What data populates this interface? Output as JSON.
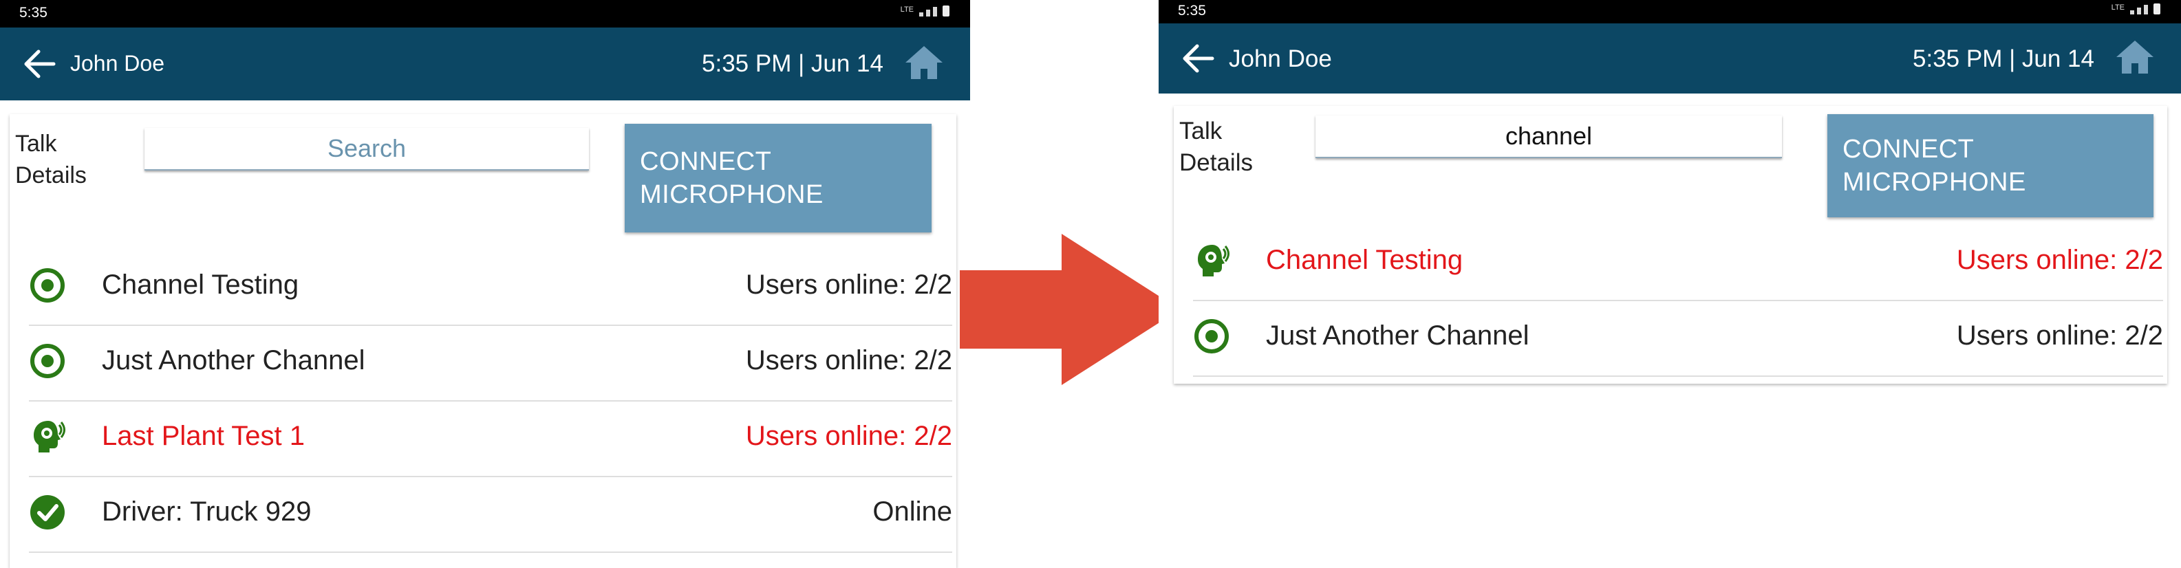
{
  "colors": {
    "appbar": "#0c4764",
    "button": "#6699b8",
    "alert_text": "#e3161a",
    "icon_green": "#2a7a16",
    "transition_arrow": "#e04b36"
  },
  "left": {
    "status_time": "5:35",
    "user_name": "John Doe",
    "datetime": "5:35 PM | Jun 14",
    "talk_label": "Talk\nDetails",
    "search": {
      "placeholder": "Search",
      "value": ""
    },
    "connect_label": "CONNECT\nMICROPHONE",
    "rows": [
      {
        "name": "Channel Testing",
        "status": "Users online: 2/2",
        "icon": "target-icon",
        "alert": false
      },
      {
        "name": "Just Another Channel",
        "status": "Users online: 2/2",
        "icon": "target-icon",
        "alert": false
      },
      {
        "name": "Last Plant Test 1",
        "status": "Users online: 2/2",
        "icon": "talking-head-icon",
        "alert": true
      },
      {
        "name": "Driver: Truck 929",
        "status": "Online",
        "icon": "check-circle-icon",
        "alert": false
      }
    ]
  },
  "right": {
    "status_time": "5:35",
    "user_name": "John Doe",
    "datetime": "5:35 PM | Jun 14",
    "talk_label": "Talk\nDetails",
    "search": {
      "placeholder": "Search",
      "value": "channel"
    },
    "connect_label": "CONNECT\nMICROPHONE",
    "rows": [
      {
        "name": "Channel Testing",
        "status": "Users online: 2/2",
        "icon": "talking-head-icon",
        "alert": true
      },
      {
        "name": "Just Another Channel",
        "status": "Users online: 2/2",
        "icon": "target-icon",
        "alert": false
      }
    ]
  }
}
